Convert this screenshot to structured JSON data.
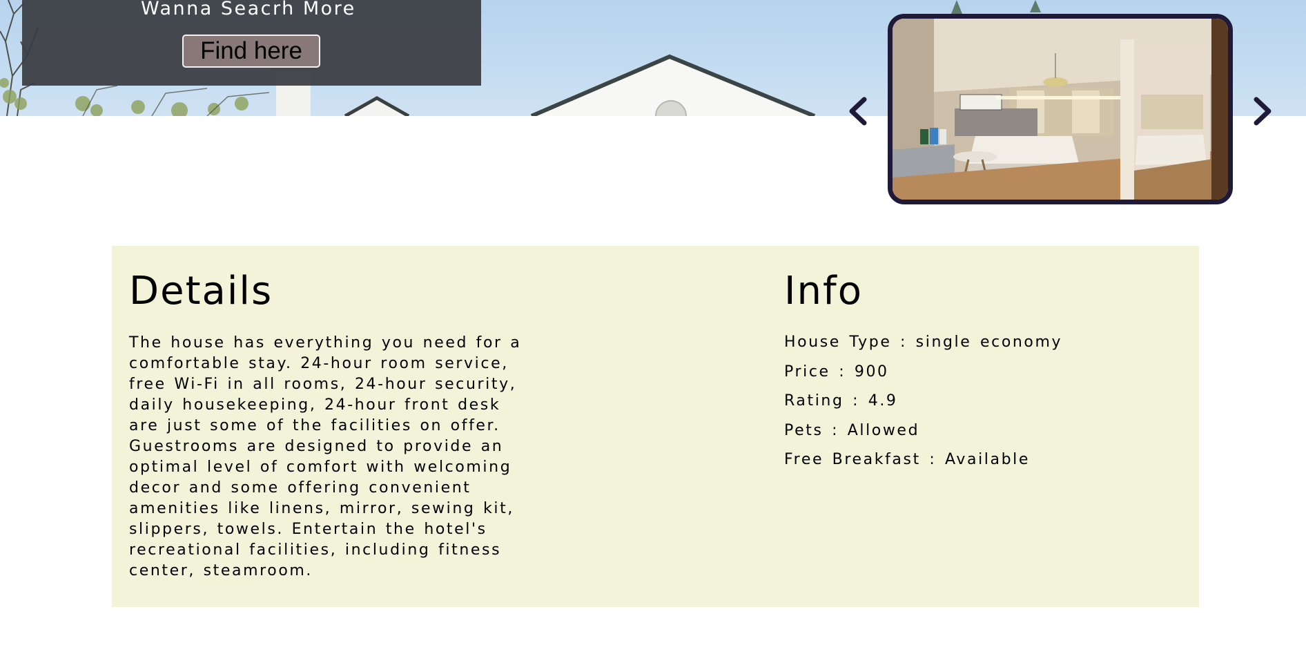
{
  "hero": {
    "search_prompt": "Wanna Seacrh More",
    "find_button_label": "Find here"
  },
  "carousel": {
    "prev_icon": "chevron-left-icon",
    "next_icon": "chevron-right-icon",
    "frame_color": "#1f1a38"
  },
  "details": {
    "heading": "Details",
    "description": "The house has everything you need for a comfortable stay. 24-hour room service, free Wi-Fi in all rooms, 24-hour security, daily housekeeping, 24-hour front desk are just some of the facilities on offer. Guestrooms are designed to provide an optimal level of comfort with welcoming decor and some offering convenient amenities like linens, mirror, sewing kit, slippers, towels. Entertain the hotel's recreational facilities, including fitness center, steamroom."
  },
  "info": {
    "heading": "Info",
    "items": [
      "House Type : single economy",
      "Price : 900",
      "Rating : 4.9",
      "Pets : Allowed",
      "Free Breakfast : Available"
    ]
  },
  "colors": {
    "card_background": "#f3f3da",
    "search_panel": "#3a3c42",
    "find_button": "#887878"
  }
}
